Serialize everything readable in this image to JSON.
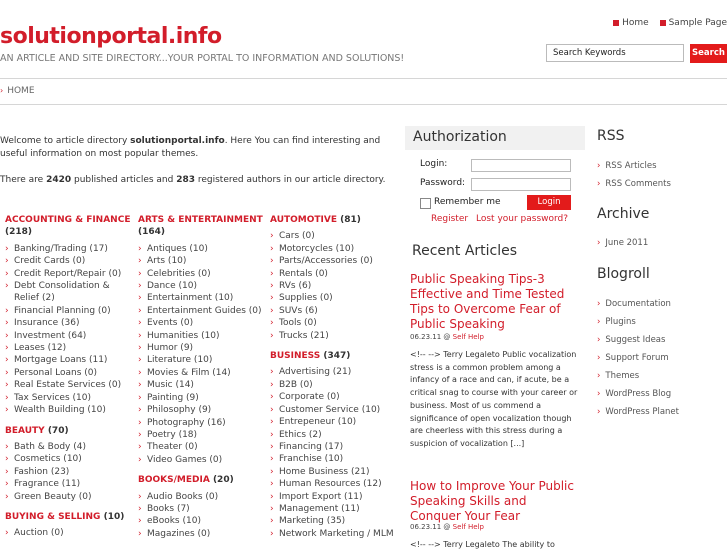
{
  "header": {
    "site_title": "solutionportal.info",
    "tagline": "AN ARTICLE AND SITE DIRECTORY...YOUR PORTAL TO INFORMATION AND SOLUTIONS!",
    "top_links": [
      "Home",
      "Sample Page"
    ],
    "search_placeholder": "Search Keywords",
    "search_button": "Search"
  },
  "nav": {
    "home": "HOME"
  },
  "intro": {
    "p1_pre": "Welcome to article directory ",
    "p1_site": "solutionportal.info",
    "p1_post": ". Here You can find interesting and useful information on most popular themes.",
    "p2_pre": "There are ",
    "articles_count": "2420",
    "p2_mid": " published articles and ",
    "authors_count": "283",
    "p2_post": " registered authors in our article directory."
  },
  "categories": {
    "col1": [
      {
        "name": "ACCOUNTING & FINANCE",
        "count": "(218)",
        "items": [
          "Banking/Trading (17)",
          "Credit Cards (0)",
          "Credit Report/Repair (0)",
          "Debt Consolidation & Relief (2)",
          "Financial Planning (0)",
          "Insurance (36)",
          "Investment (64)",
          "Leases (12)",
          "Mortgage Loans (11)",
          "Personal Loans (0)",
          "Real Estate Services (0)",
          "Tax Services (10)",
          "Wealth Building (10)"
        ]
      },
      {
        "name": "BEAUTY",
        "count": "(70)",
        "items": [
          "Bath & Body (4)",
          "Cosmetics (10)",
          "Fashion (23)",
          "Fragrance (11)",
          "Green Beauty (0)"
        ]
      },
      {
        "name": "BUYING & SELLING",
        "count": "(10)",
        "items": [
          "Auction (0)"
        ]
      }
    ],
    "col2": [
      {
        "name": "ARTS & ENTERTAINMENT",
        "count": "(164)",
        "items": [
          "Antiques (10)",
          "Arts (10)",
          "Celebrities (0)",
          "Dance (10)",
          "Entertainment (10)",
          "Entertainment Guides (0)",
          "Events (0)",
          "Humanities (10)",
          "Humor (9)",
          "Literature (10)",
          "Movies & Film (14)",
          "Music (14)",
          "Painting (9)",
          "Philosophy (9)",
          "Photography (16)",
          "Poetry (18)",
          "Theater (0)",
          "Video Games (0)"
        ]
      },
      {
        "name": "BOOKS/MEDIA",
        "count": "(20)",
        "items": [
          "Audio Books (0)",
          "Books (7)",
          "eBooks (10)",
          "Magazines (0)"
        ]
      }
    ],
    "col3": [
      {
        "name": "AUTOMOTIVE",
        "count": "(81)",
        "items": [
          "Cars (0)",
          "Motorcycles (10)",
          "Parts/Accessories (0)",
          "Rentals (0)",
          "RVs (6)",
          "Supplies (0)",
          "SUVs (6)",
          "Tools (0)",
          "Trucks (21)"
        ]
      },
      {
        "name": "BUSINESS",
        "count": "(347)",
        "items": [
          "Advertising (21)",
          "B2B (0)",
          "Corporate (0)",
          "Customer Service (10)",
          "Entrepeneur (10)",
          "Ethics (2)",
          "Financing (17)",
          "Franchise (10)",
          "Home Business (21)",
          "Human Resources (12)",
          "Import Export (11)",
          "Management (11)",
          "Marketing (35)",
          "Network Marketing / MLM"
        ]
      }
    ]
  },
  "auth": {
    "title": "Authorization",
    "login_label": "Login:",
    "password_label": "Password:",
    "remember": "Remember me",
    "login_button": "Login",
    "register": "Register",
    "lost_password": "Lost your password?"
  },
  "recent": {
    "title": "Recent Articles",
    "posts": [
      {
        "title": "Public Speaking Tips-3 Effective and Time Tested Tips to Overcome Fear of Public Speaking",
        "date": "06.23.11 @ ",
        "category": "Self Help",
        "excerpt": "<!-- --> Terry Legaleto Public vocalization stress is a common problem among a infancy of a race and can, if acute, be a critical snag to course with your career or business. Most of us commend a significance of open vocalization though are cheerless with this stress during a suspicion of vocalization [...]"
      },
      {
        "title": "How to Improve Your Public Speaking Skills and Conquer Your Fear",
        "date": "06.23.11 @ ",
        "category": "Self Help",
        "excerpt": "<!-- --> Terry Legaleto The ability to"
      }
    ]
  },
  "right": {
    "rss_title": "RSS",
    "rss_items": [
      "RSS Articles",
      "RSS Comments"
    ],
    "archive_title": "Archive",
    "archive_items": [
      "June 2011"
    ],
    "blogroll_title": "Blogroll",
    "blogroll_items": [
      "Documentation",
      "Plugins",
      "Suggest Ideas",
      "Support Forum",
      "Themes",
      "WordPress Blog",
      "WordPress Planet"
    ]
  },
  "colors": {
    "accent": "#d21d2a",
    "button": "#e31b1b"
  }
}
